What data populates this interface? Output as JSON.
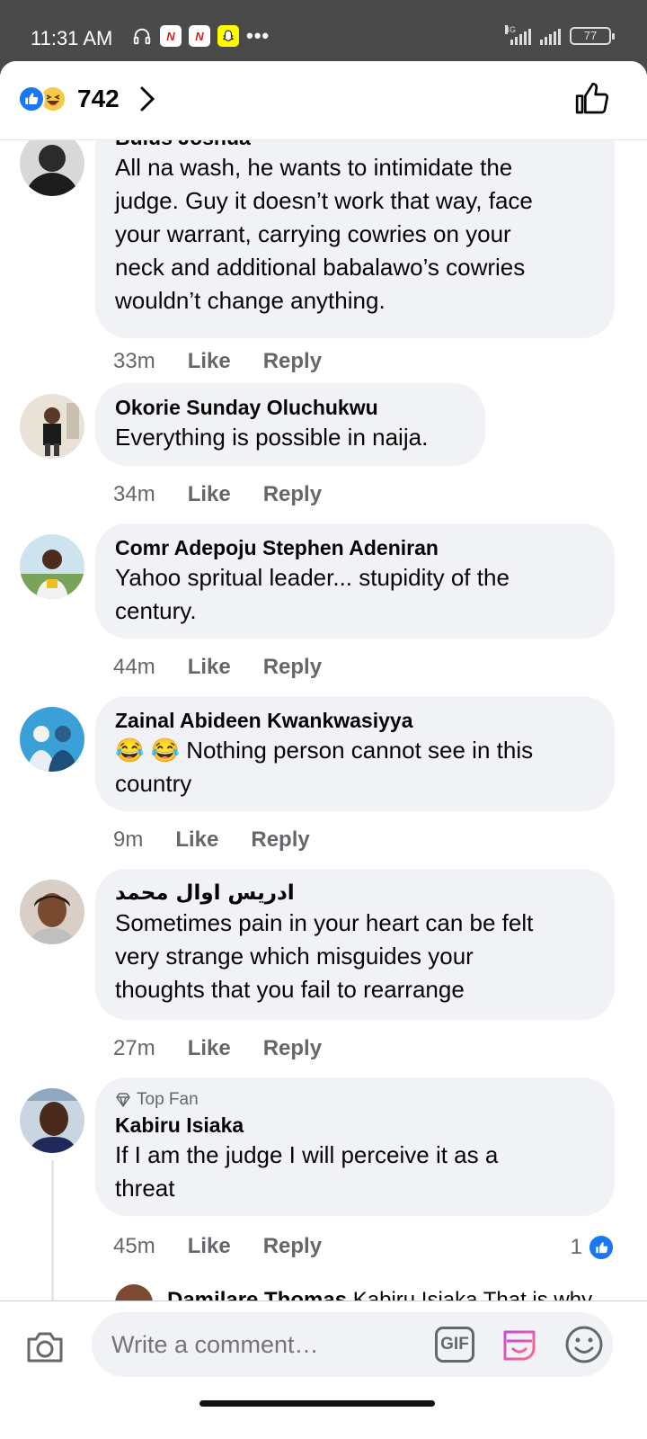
{
  "status_bar": {
    "time": "11:31 AM",
    "network": "4G",
    "battery": "77"
  },
  "header": {
    "reaction_count": "742"
  },
  "comments": [
    {
      "author": "Bulus Joshua",
      "lines": [
        "All na wash, he wants to intimidate the",
        "judge. Guy it doesn’t work that way, face",
        "your warrant, carrying cowries on your",
        "neck and additional babalawo’s cowries",
        "wouldn’t change anything."
      ],
      "time": "33m",
      "like": "Like",
      "reply": "Reply"
    },
    {
      "author": "Okorie Sunday Oluchukwu",
      "lines": [
        "Everything is possible in naija."
      ],
      "time": "34m",
      "like": "Like",
      "reply": "Reply"
    },
    {
      "author": "Comr Adepoju Stephen Adeniran",
      "lines": [
        "Yahoo spritual leader... stupidity of the",
        "century."
      ],
      "time": "44m",
      "like": "Like",
      "reply": "Reply"
    },
    {
      "author": "Zainal Abideen Kwankwasiyya",
      "lines": [
        "😂 😂 Nothing person cannot see in this",
        "country"
      ],
      "time": "9m",
      "like": "Like",
      "reply": "Reply"
    },
    {
      "author": "ادريس اوال محمد",
      "lines": [
        "Sometimes pain in your heart can be felt",
        "very strange which misguides your",
        "thoughts that you fail to rearrange"
      ],
      "time": "27m",
      "like": "Like",
      "reply": "Reply"
    },
    {
      "badge": "Top Fan",
      "author": "Kabiru Isiaka",
      "lines": [
        "If I am the judge I will perceive it as a",
        "threat"
      ],
      "time": "45m",
      "like": "Like",
      "reply": "Reply",
      "reaction_count": "1"
    }
  ],
  "partial_reply": {
    "author": "Damilare Thomas",
    "text": "Kabiru Isiaka  That is why"
  },
  "compose": {
    "placeholder": "Write a comment…",
    "gif_label": "GIF"
  }
}
